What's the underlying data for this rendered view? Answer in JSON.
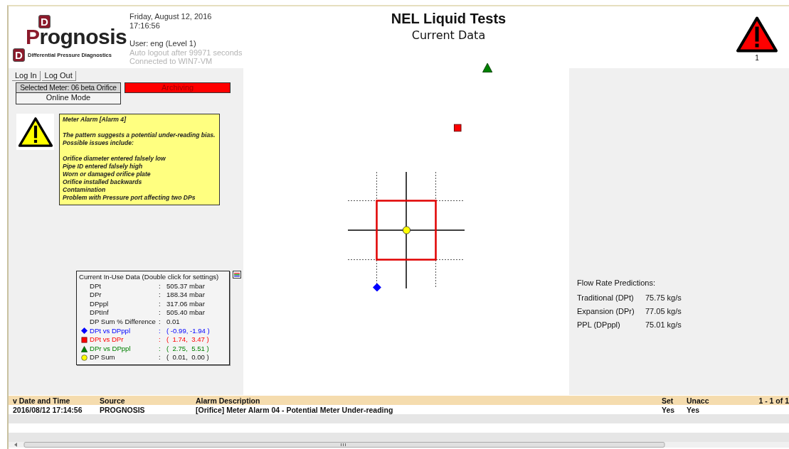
{
  "header": {
    "logo": {
      "letters": [
        "D",
        "D"
      ],
      "wordmark": "Prognosis",
      "tagline": "Differential Pressure Diagnostics"
    },
    "date": "Friday, August 12, 2016",
    "time": "17:16:56",
    "user": "User: eng (Level 1)",
    "logout": "Auto logout after 99971 seconds",
    "connection": "Connected to WIN7-VM",
    "title": "NEL Liquid Tests",
    "subtitle": "Current Data",
    "alarm_count": "1"
  },
  "controls": {
    "buttons": [
      "Log In",
      "Log Out"
    ],
    "meter": "Selected Meter: 06 beta Orifice",
    "archiving": {
      "label": "Archiving",
      "on": true
    },
    "mode": "Online Mode"
  },
  "alarm_note": {
    "title": "Meter Alarm [Alarm 4]",
    "message": [
      "The pattern suggests a potential under-reading bias.",
      "Possible issues include:"
    ],
    "issues": [
      "Orifice diameter entered falsely low",
      "Pipe ID entered falsely high",
      "Worn or damaged orifice plate",
      "Orifice installed backwards",
      "Contamination",
      "Problem with Pressure port affecting two DPs"
    ]
  },
  "in_use_data": {
    "title": "Current In-Use Data (Double click for settings)",
    "rows": [
      {
        "kind": "plain",
        "label": "DPt",
        "sep": ":",
        "value": "505.37 mbar"
      },
      {
        "kind": "plain",
        "label": "DPr",
        "sep": ":",
        "value": "188.34 mbar"
      },
      {
        "kind": "plain",
        "label": "DPppl",
        "sep": ":",
        "value": "317.06 mbar"
      },
      {
        "kind": "plain",
        "label": "DPtInf",
        "sep": ":",
        "value": "505.40 mbar"
      },
      {
        "kind": "plain",
        "label": "DP Sum % Difference",
        "sep": ":",
        "value": "0.01"
      },
      {
        "kind": "diamond",
        "label": "DPt vs DPppl",
        "sep": ":",
        "value": "( -0.99, -1.94 )",
        "color": "#0000ff"
      },
      {
        "kind": "square",
        "label": "DPt vs DPr",
        "sep": ":",
        "value": "(  1.74,  3.47 )",
        "color": "#ff0000"
      },
      {
        "kind": "triangle",
        "label": "DPr vs DPppl",
        "sep": ":",
        "value": "(  2.75,  5.51 )",
        "color": "#008000"
      },
      {
        "kind": "circle",
        "label": "DP Sum",
        "sep": ":",
        "value": "(  0.01,  0.00 )",
        "color": "#ffff00"
      }
    ]
  },
  "flow_rates": {
    "title": "Flow Rate Predictions:",
    "rows": [
      {
        "label": "Traditional (DPt)",
        "value": "75.75 kg/s"
      },
      {
        "label": "Expansion (DPr)",
        "value": "77.05 kg/s"
      },
      {
        "label": "PPL (DPppl)",
        "value": "75.01 kg/s"
      }
    ]
  },
  "alarm_table": {
    "columns": [
      "v Date and Time",
      "Source",
      "Alarm Description",
      "Set",
      "Unacc"
    ],
    "paging": "1 - 1 of 1",
    "rows": [
      [
        "2016/08/12 17:14:56",
        "PROGNOSIS",
        "[Orifice] Meter Alarm 04 - Potential Meter Under-reading",
        "Yes",
        "Yes"
      ]
    ]
  }
}
